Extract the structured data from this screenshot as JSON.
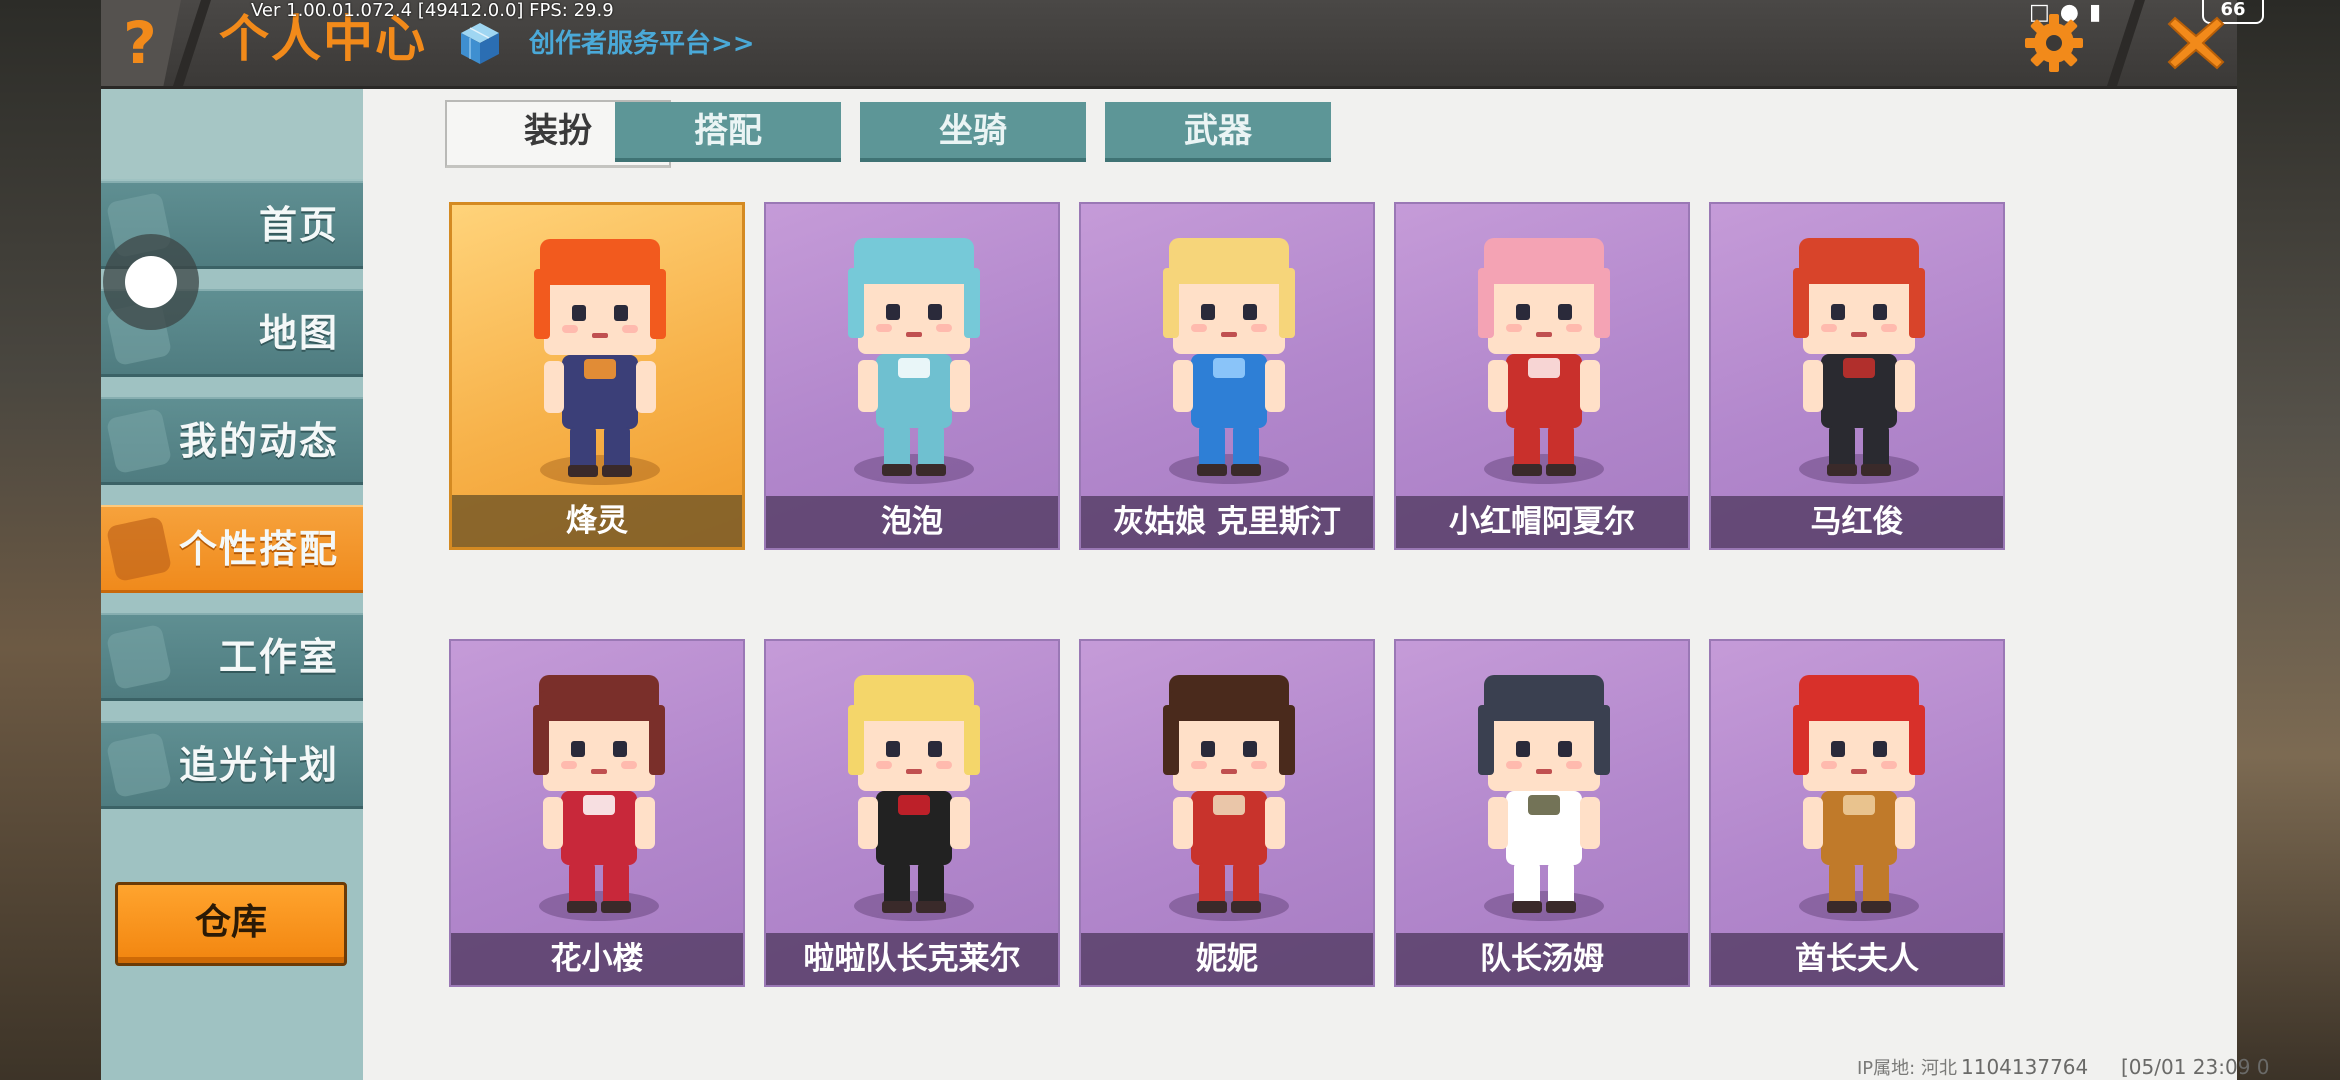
{
  "overlay": {
    "debug_text": "Ver 1.00.01.072.4 [49412.0.0] FPS: 29.9"
  },
  "header": {
    "title": "个人中心",
    "creator_link": "创作者服务平台>>",
    "battery": "66"
  },
  "sidebar": {
    "items": [
      {
        "label": "首页"
      },
      {
        "label": "地图"
      },
      {
        "label": "我的动态"
      },
      {
        "label": "个性搭配"
      },
      {
        "label": "工作室"
      },
      {
        "label": "追光计划"
      }
    ],
    "active_index": 3,
    "warehouse_label": "仓库"
  },
  "tabs": [
    {
      "label": "装扮",
      "active": true
    },
    {
      "label": "搭配",
      "active": false
    },
    {
      "label": "坐骑",
      "active": false
    },
    {
      "label": "武器",
      "active": false
    }
  ],
  "skins": [
    {
      "name": "烽灵",
      "hair": "#f25a1e",
      "outfit": "#3b3f78",
      "accent": "#ff9a2a",
      "rarity": "gold"
    },
    {
      "name": "泡泡",
      "hair": "#76c9d8",
      "outfit": "#6fc0d0",
      "accent": "#ffffff",
      "rarity": "purple"
    },
    {
      "name": "灰姑娘 克里斯汀",
      "hair": "#f6d57a",
      "outfit": "#2e7fd6",
      "accent": "#9ad0ff",
      "rarity": "purple"
    },
    {
      "name": "小红帽阿夏尔",
      "hair": "#f4a3b4",
      "outfit": "#c9302c",
      "accent": "#fff2f2",
      "rarity": "purple"
    },
    {
      "name": "马红俊",
      "hair": "#d8442a",
      "outfit": "#2a2a30",
      "accent": "#c9302c",
      "rarity": "purple"
    },
    {
      "name": "花小楼",
      "hair": "#7a2f2a",
      "outfit": "#c8283a",
      "accent": "#ffffff",
      "rarity": "purple"
    },
    {
      "name": "啦啦队长克莱尔",
      "hair": "#f4d66a",
      "outfit": "#222222",
      "accent": "#d8202a",
      "rarity": "purple"
    },
    {
      "name": "妮妮",
      "hair": "#4a2a1c",
      "outfit": "#c8332c",
      "accent": "#f0e0c0",
      "rarity": "purple"
    },
    {
      "name": "队长汤姆",
      "hair": "#3a4050",
      "outfit": "#ffffff",
      "accent": "#5a5a3a",
      "rarity": "purple"
    },
    {
      "name": "酋长夫人",
      "hair": "#d8302a",
      "outfit": "#c07a2a",
      "accent": "#f0d0a0",
      "rarity": "purple"
    }
  ],
  "footer": {
    "ip_location": "IP属地: 河北",
    "user_id": "1104137764",
    "timestamp": "[05/01 23:09 0"
  },
  "colors": {
    "accent_orange": "#f28a1a",
    "teal_tab": "#5d9697",
    "card_purple": "#b287cc"
  }
}
